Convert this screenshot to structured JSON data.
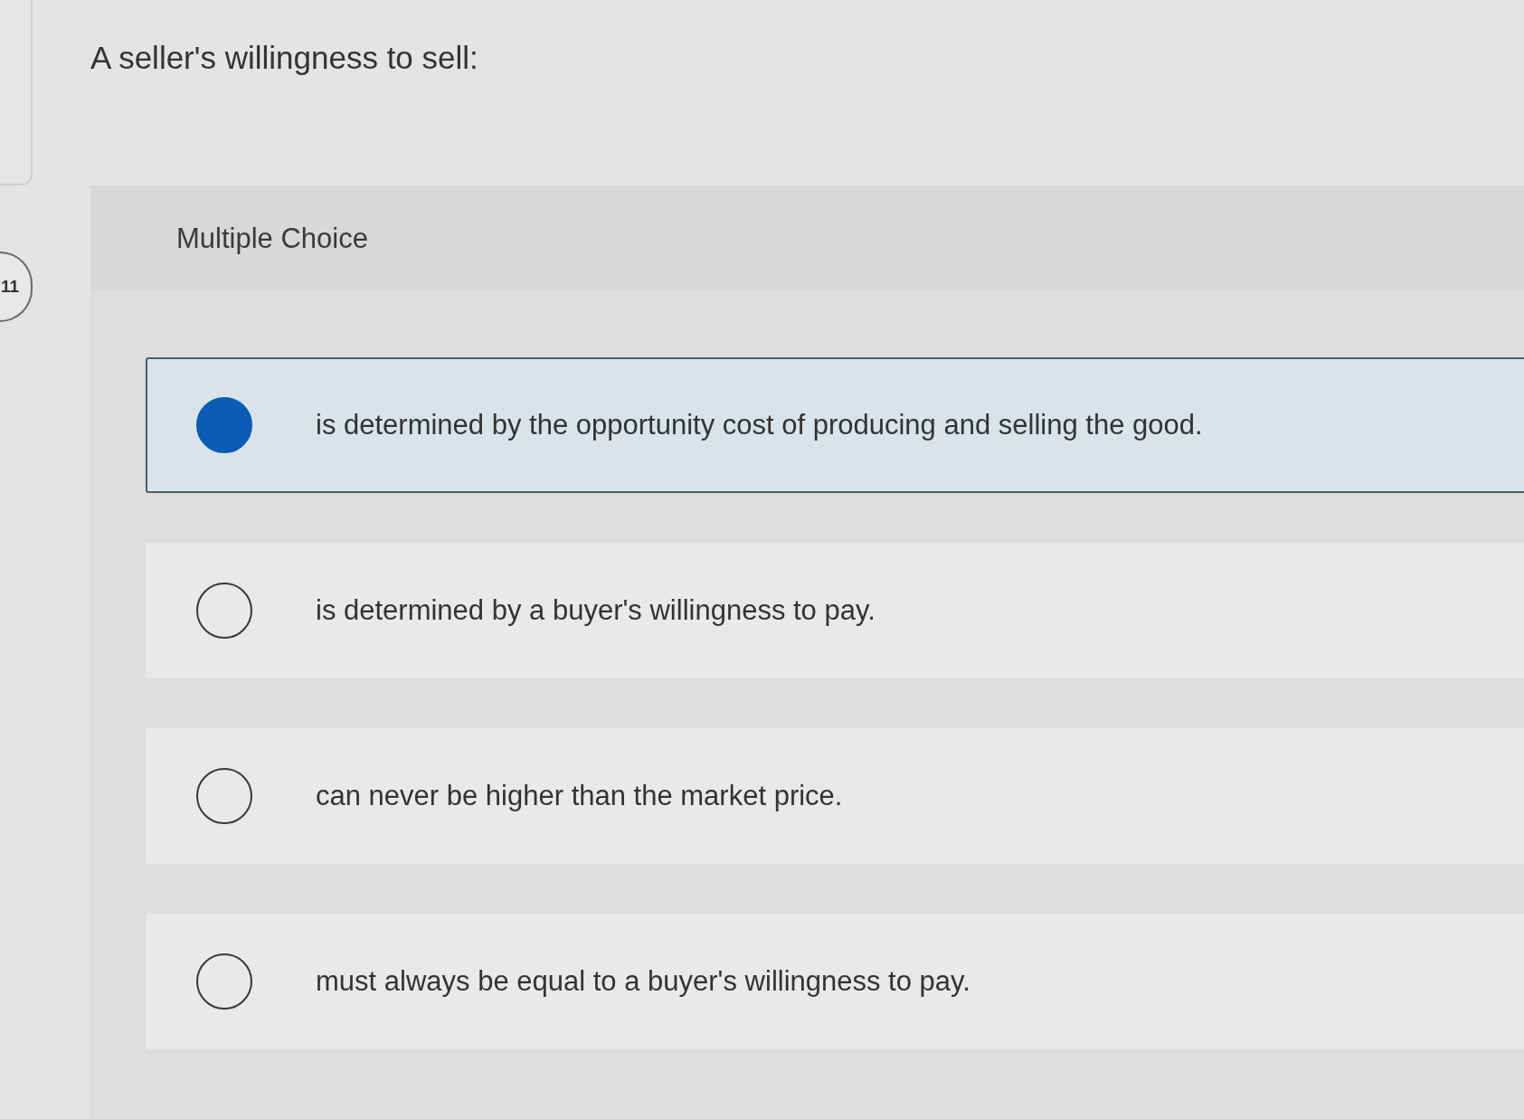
{
  "side_badge": {
    "label": "11"
  },
  "question": {
    "text": "A seller's willingness to sell:"
  },
  "answer_panel": {
    "label": "Multiple Choice",
    "options": [
      {
        "text": "is determined by the opportunity cost of producing and selling the good.",
        "selected": true
      },
      {
        "text": "is determined by a buyer's willingness to pay.",
        "selected": false
      },
      {
        "text": "can never be higher than the market price.",
        "selected": false
      },
      {
        "text": "must always be equal to a buyer's willingness to pay.",
        "selected": false
      }
    ]
  }
}
